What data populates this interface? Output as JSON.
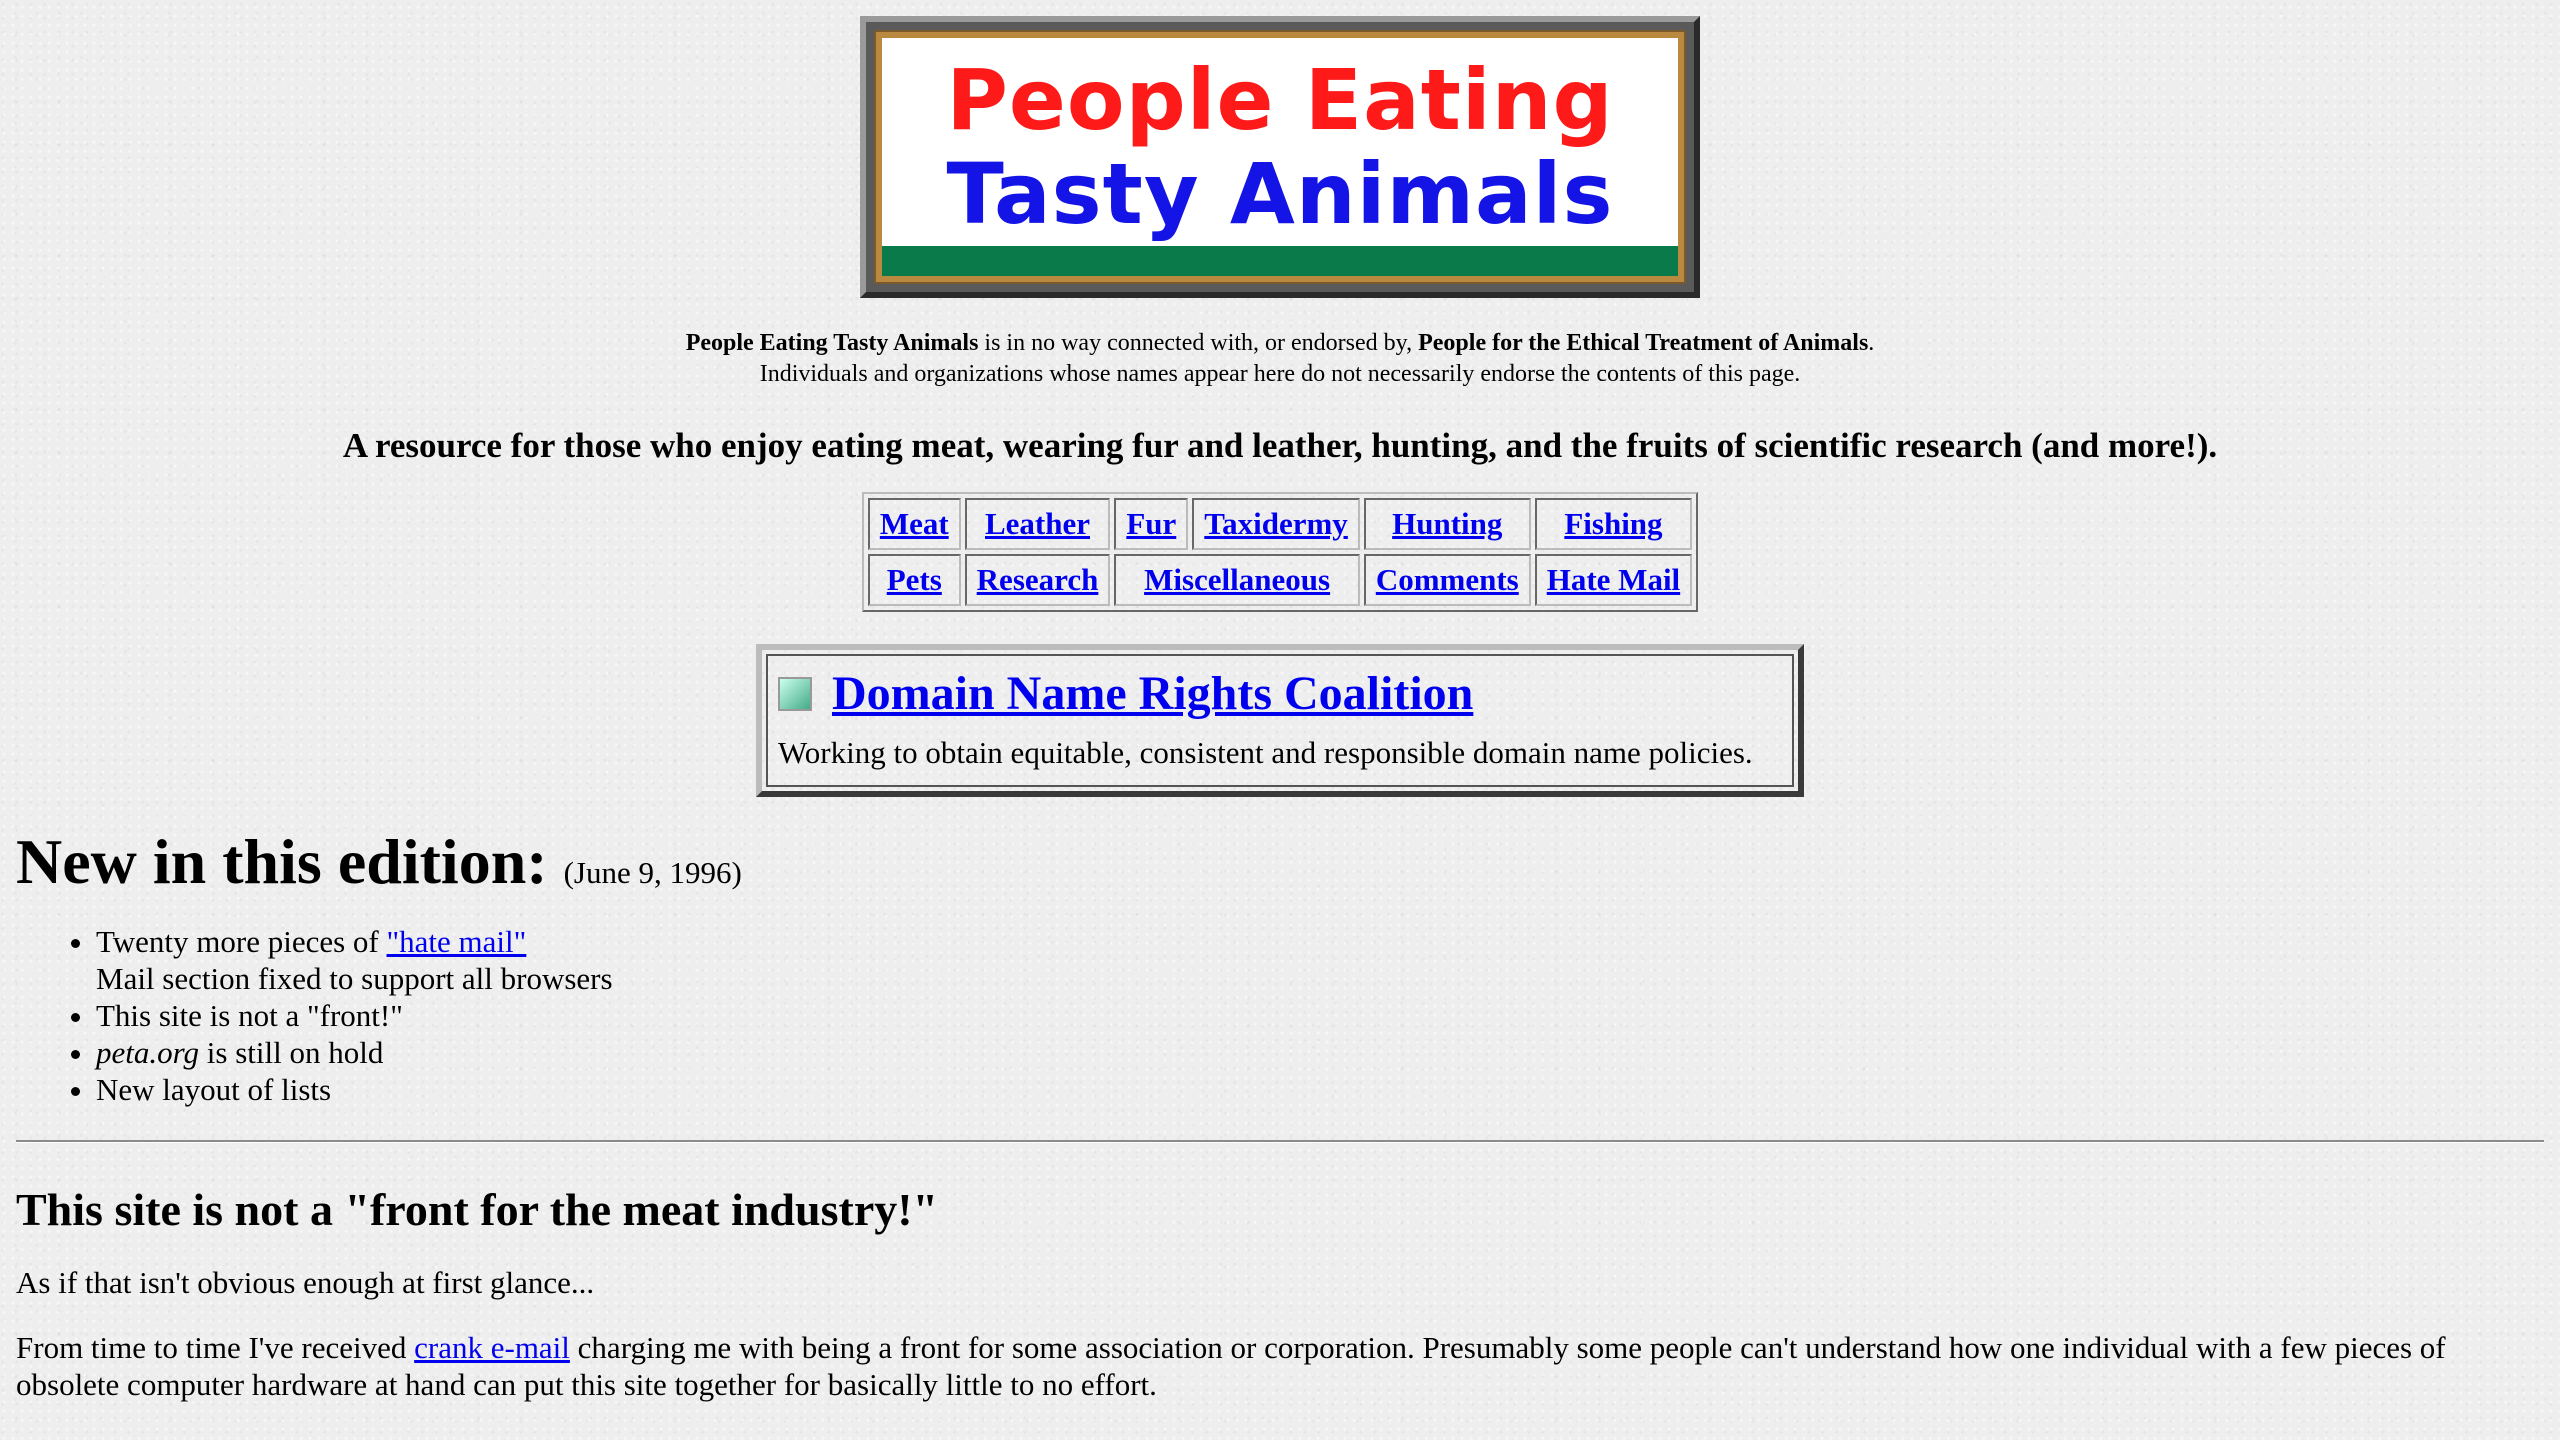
{
  "banner": {
    "line1": "People Eating",
    "line2": "Tasty Animals"
  },
  "disclaimer": {
    "org_name": "People Eating Tasty Animals",
    "middle": " is in no way connected with, or endorsed by, ",
    "peta_name": "People for the Ethical Treatment of Animals",
    "end": ".",
    "line2": "Individuals and organizations whose names appear here do not necessarily endorse the contents of this page."
  },
  "tagline": "A resource for those who enjoy eating meat, wearing fur and leather, hunting, and the fruits of scientific research (and more!).",
  "nav": {
    "row1": [
      "Meat",
      "Leather",
      "Fur",
      "Taxidermy",
      "Hunting",
      "Fishing"
    ],
    "row2": [
      "Pets",
      "Research",
      "Miscellaneous",
      "Comments",
      "Hate Mail"
    ]
  },
  "dnrc": {
    "title": "Domain Name Rights Coalition",
    "description": "Working to obtain equitable, consistent and responsible domain name policies."
  },
  "new_edition": {
    "heading": "New in this edition:",
    "date": "(June 9, 1996)",
    "item1_prefix": "Twenty more pieces of ",
    "item1_link": "\"hate mail\"",
    "item1_line2": "Mail section fixed to support all browsers",
    "item2": "This site is not a \"front!\"",
    "item3_em": "peta.org",
    "item3_rest": " is still on hold",
    "item4": "New layout of lists"
  },
  "front_section": {
    "heading": "This site is not a \"front for the meat industry!\"",
    "para1": "As if that isn't obvious enough at first glance...",
    "para2_prefix": "From time to time I've received ",
    "para2_link": "crank e-mail",
    "para2_rest": " charging me with being a front for some association or corporation. Presumably some people can't understand how one individual with a few pieces of obsolete computer hardware at hand can put this site together for basically little to no effort."
  }
}
